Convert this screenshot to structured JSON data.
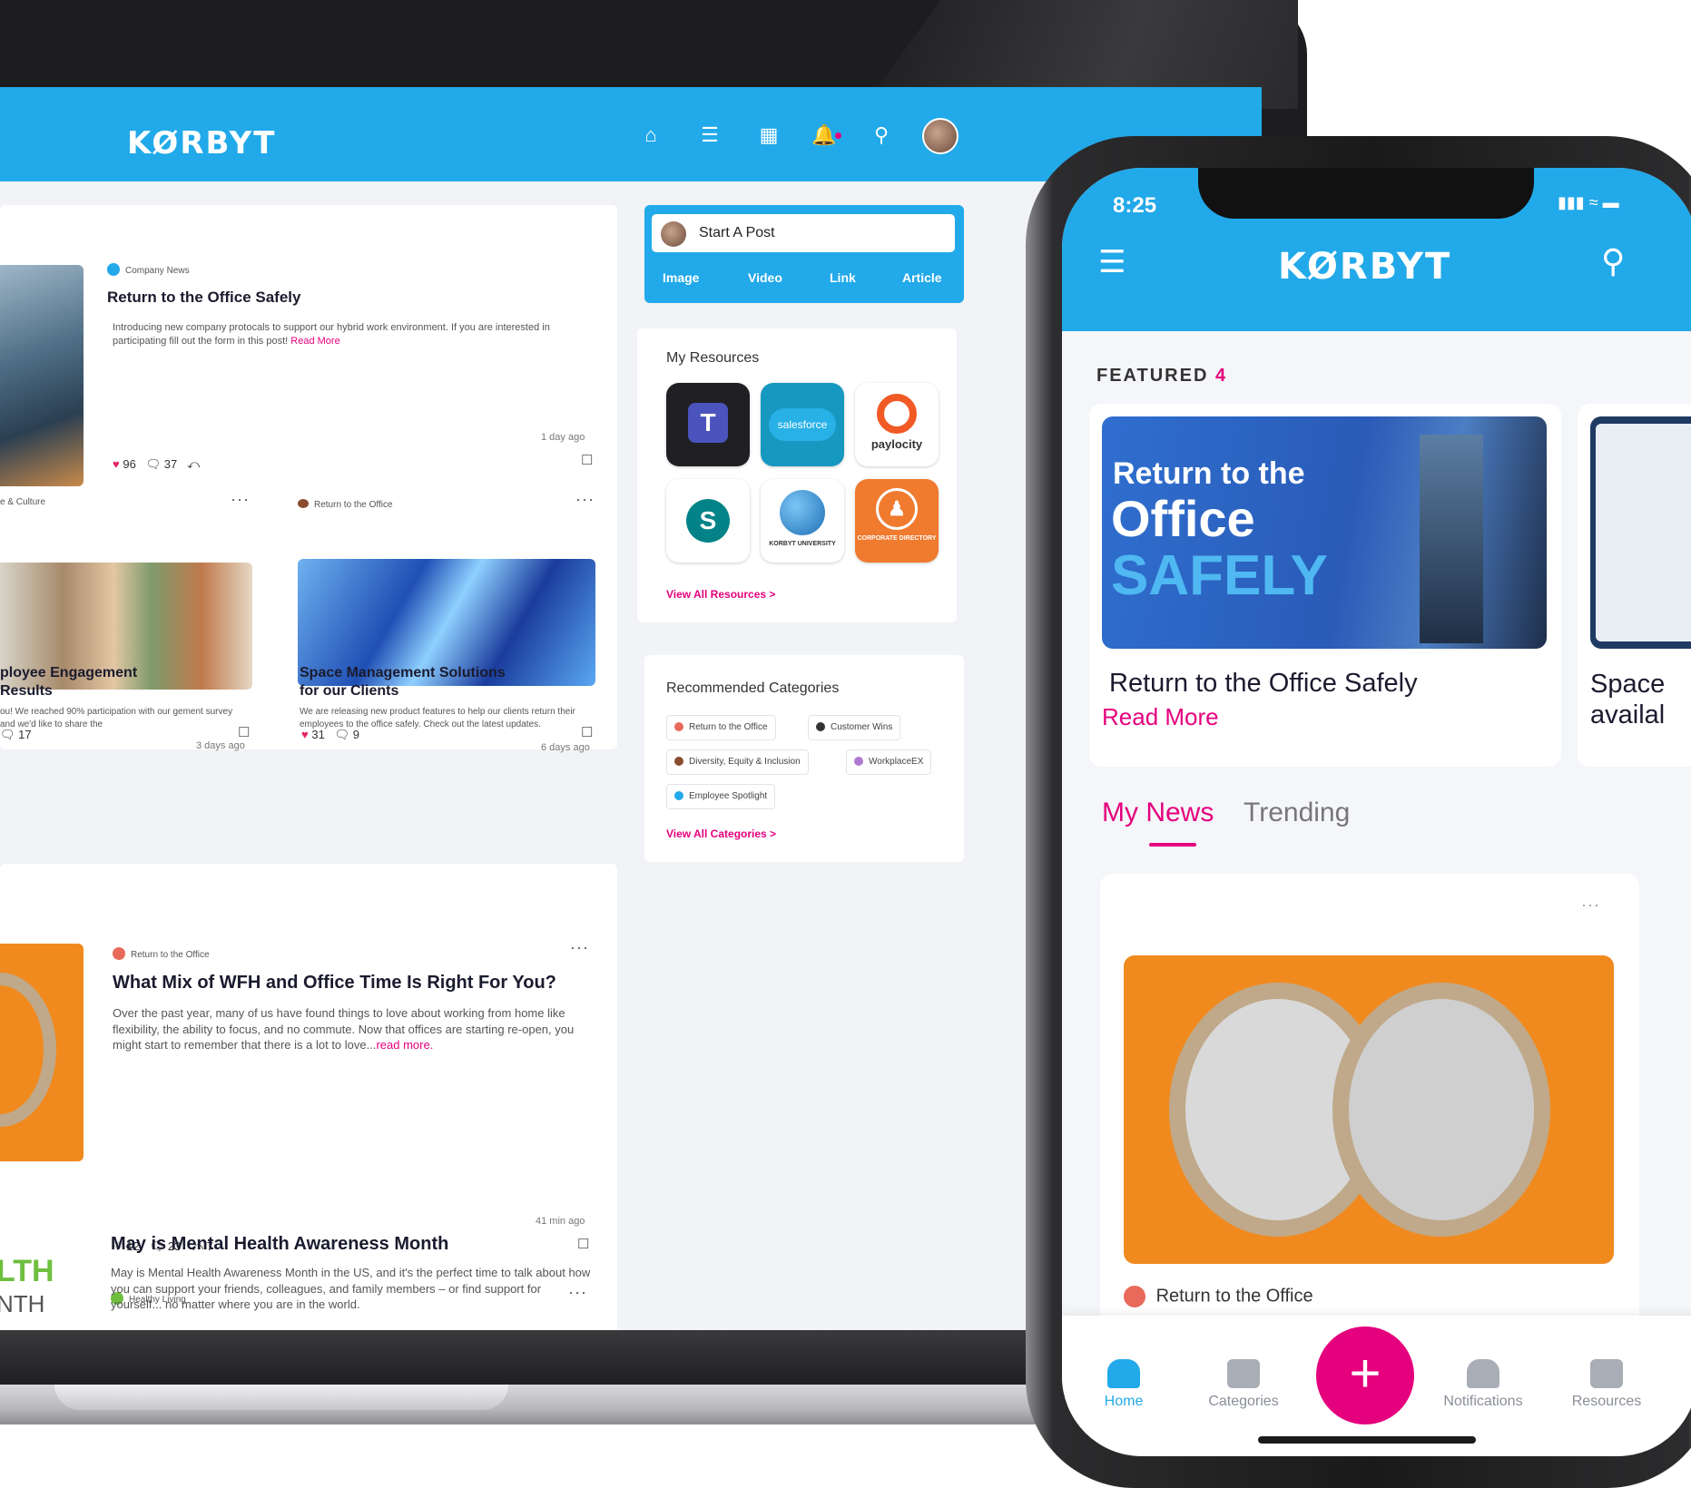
{
  "web": {
    "logo": "KØRBYT",
    "start_post": {
      "label": "Start A Post",
      "actions": [
        "Image",
        "Video",
        "Link",
        "Article"
      ]
    },
    "resources": {
      "title": "My Resources",
      "apps": [
        {
          "name": "teams-icon",
          "label": "T",
          "color": "#4b53bc"
        },
        {
          "name": "salesforce-icon",
          "label": "salesforce",
          "color": "#1798c1"
        },
        {
          "name": "paylocity-icon",
          "label": "paylocity",
          "color": "#ffffff"
        },
        {
          "name": "sharepoint-icon",
          "label": "S",
          "color": "#038387"
        },
        {
          "name": "korbyt-university-icon",
          "label": "KORBYT UNIVERSITY",
          "color": "#ffffff"
        },
        {
          "name": "corporate-directory-icon",
          "label": "CORPORATE DIRECTORY",
          "color": "#f07a2e"
        }
      ],
      "view_all": "View All Resources  >"
    },
    "categories": {
      "title": "Recommended Categories",
      "chips": [
        "Return to the Office",
        "Customer Wins",
        "Diversity, Equity & Inclusion",
        "WorkplaceEX",
        "Employee Spotlight"
      ],
      "view_all": "View All Categories  >"
    },
    "post1": {
      "category": "Company News",
      "title": "Return to the Office Safely",
      "body": "Introducing new company protocals to support our hybrid work environment.  If you are interested in participating fill out the form in this post!",
      "read_more": "Read More",
      "time": "1 day ago",
      "likes": "96",
      "comments": "37"
    },
    "post2": {
      "category": "e & Culture",
      "title_line1": "ployee Engagement",
      "title_line2": "Results",
      "body": "ou! We reached 90% participation with our gement survey and we'd like to share the",
      "time": "3 days ago",
      "comments": "17"
    },
    "post3": {
      "category": "Return to the Office",
      "title_line1": "Space Management Solutions",
      "title_line2": "for our Clients",
      "body": "We are releasing new product features to help our clients return their employees to the office safely. Check out the latest updates.",
      "time": "6 days ago",
      "likes": "31",
      "comments": "9"
    },
    "post4": {
      "category": "Return to the Office",
      "title": "What Mix of WFH and Office Time Is Right For You?",
      "body": "Over the past year, many of us have found things to love about working from home like flexibility, the ability to focus, and no commute. Now that offices are starting re-open, you might start to remember that there is a lot to love...",
      "read_more": "read more.",
      "time": "41 min ago",
      "likes": "12",
      "comments": "23",
      "shares": "7"
    },
    "post5": {
      "category": "Healthy Living",
      "title": "May is Mental Health Awareness Month",
      "body": "May is Mental Health Awareness Month in the US, and it's the perfect time to talk about how you can support your friends, colleagues, and family members – or find support for yourself... no matter where you are in the world.",
      "side_text1": "LTH",
      "side_text2": "NTH"
    }
  },
  "phone": {
    "time": "8:25",
    "logo": "KØRBYT",
    "featured_label": "FEATURED",
    "featured_count": "4",
    "featured_banner": {
      "line1": "Return to the",
      "line2": "Office",
      "line3": "SAFELY"
    },
    "featured_title": "Return to the Office Safely",
    "featured_read_more": "Read More",
    "second_card_title_line1": "Space",
    "second_card_title_line2": "availal",
    "tabs": [
      "My News",
      "Trending"
    ],
    "news_category": "Return to the Office",
    "bottom_nav": [
      "Home",
      "Categories",
      "Notifications",
      "Resources"
    ],
    "colors": {
      "brand": "#22a9e9",
      "accent": "#e5007d"
    }
  }
}
